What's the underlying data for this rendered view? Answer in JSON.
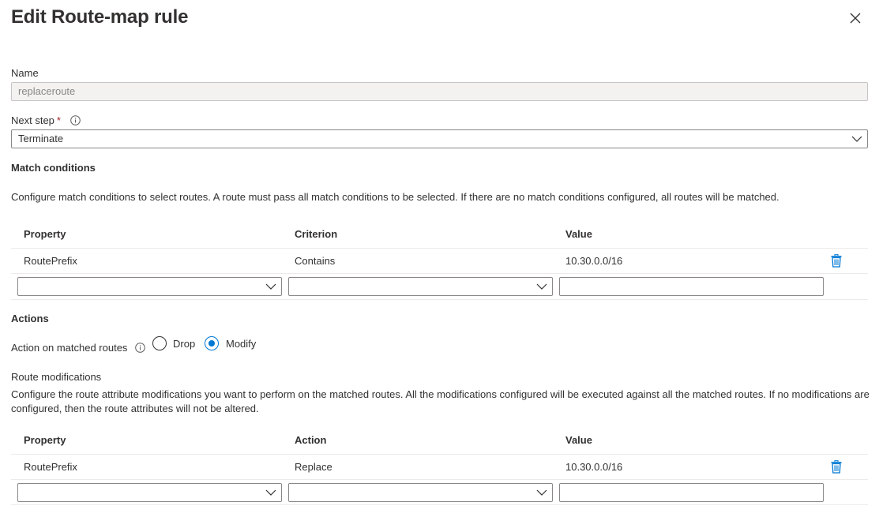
{
  "panel": {
    "title": "Edit Route-map rule"
  },
  "name_field": {
    "label": "Name",
    "value": "replaceroute"
  },
  "next_step": {
    "label": "Next step",
    "required_mark": "*",
    "value": "Terminate"
  },
  "match_conditions": {
    "title": "Match conditions",
    "description": "Configure match conditions to select routes. A route must pass all match conditions to be selected. If there are no match conditions configured, all routes will be matched.",
    "columns": [
      "Property",
      "Criterion",
      "Value"
    ],
    "rows": [
      {
        "property": "RoutePrefix",
        "criterion": "Contains",
        "value": "10.30.0.0/16"
      }
    ],
    "new_row": {
      "property": "",
      "criterion": "",
      "value": ""
    }
  },
  "actions": {
    "title": "Actions",
    "action_label": "Action on matched routes",
    "options": [
      {
        "label": "Drop",
        "checked": false
      },
      {
        "label": "Modify",
        "checked": true
      }
    ]
  },
  "route_modifications": {
    "title": "Route modifications",
    "description": "Configure the route attribute modifications you want to perform on the matched routes. All the modifications configured will be executed against all the matched routes. If no modifications are configured, then the route attributes will not be altered.",
    "columns": [
      "Property",
      "Action",
      "Value"
    ],
    "rows": [
      {
        "property": "RoutePrefix",
        "action": "Replace",
        "value": "10.30.0.0/16"
      }
    ],
    "new_row": {
      "property": "",
      "action": "",
      "value": ""
    }
  },
  "colors": {
    "accent": "#0078d4",
    "required": "#a4262c",
    "border": "#8a8886",
    "divider": "#edebe9"
  },
  "icons": [
    "close-icon",
    "info-icon",
    "chevron-down-icon",
    "trash-icon"
  ]
}
